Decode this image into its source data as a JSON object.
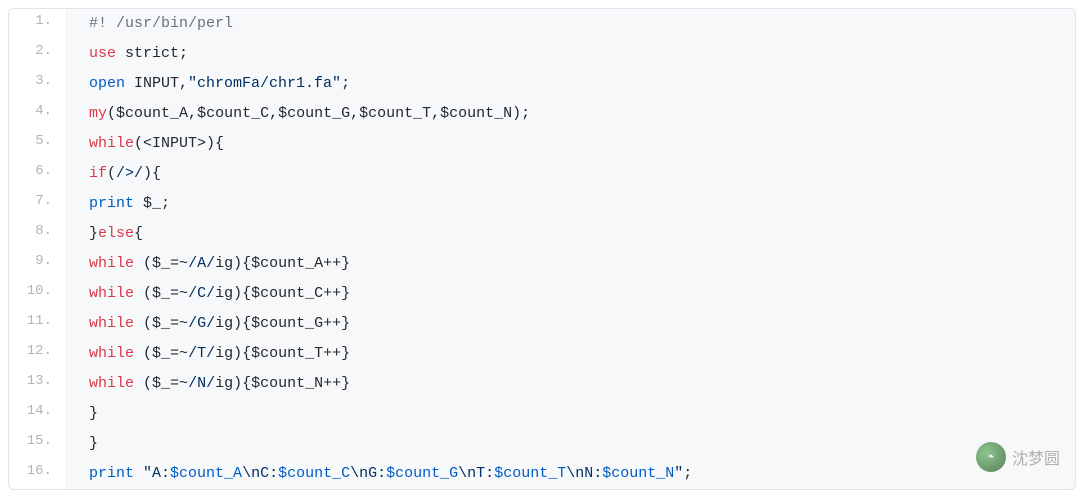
{
  "watermark": {
    "text": "沈梦圆"
  },
  "code": {
    "lines": [
      {
        "n": "1.",
        "tokens": [
          {
            "t": "#! /usr/bin/perl",
            "c": "tok-comment"
          }
        ]
      },
      {
        "n": "2.",
        "tokens": [
          {
            "t": "use",
            "c": "tok-keyword"
          },
          {
            "t": " ",
            "c": "tok-plain"
          },
          {
            "t": "strict",
            "c": "tok-plain"
          },
          {
            "t": ";",
            "c": "tok-punct"
          }
        ]
      },
      {
        "n": "3.",
        "tokens": [
          {
            "t": "open",
            "c": "tok-func"
          },
          {
            "t": " INPUT,",
            "c": "tok-plain"
          },
          {
            "t": "\"chromFa/chr1.fa\"",
            "c": "tok-string"
          },
          {
            "t": ";",
            "c": "tok-punct"
          }
        ]
      },
      {
        "n": "4.",
        "tokens": [
          {
            "t": "my",
            "c": "tok-keyword"
          },
          {
            "t": "(",
            "c": "tok-punct"
          },
          {
            "t": "$count_A",
            "c": "tok-var"
          },
          {
            "t": ",",
            "c": "tok-punct"
          },
          {
            "t": "$count_C",
            "c": "tok-var"
          },
          {
            "t": ",",
            "c": "tok-punct"
          },
          {
            "t": "$count_G",
            "c": "tok-var"
          },
          {
            "t": ",",
            "c": "tok-punct"
          },
          {
            "t": "$count_T",
            "c": "tok-var"
          },
          {
            "t": ",",
            "c": "tok-punct"
          },
          {
            "t": "$count_N",
            "c": "tok-var"
          },
          {
            "t": ");",
            "c": "tok-punct"
          }
        ]
      },
      {
        "n": "5.",
        "tokens": [
          {
            "t": "while",
            "c": "tok-keyword"
          },
          {
            "t": "(<INPUT>){",
            "c": "tok-plain"
          }
        ]
      },
      {
        "n": "6.",
        "tokens": [
          {
            "t": "if",
            "c": "tok-keyword"
          },
          {
            "t": "(",
            "c": "tok-punct"
          },
          {
            "t": "/>/",
            "c": "tok-regex"
          },
          {
            "t": "){",
            "c": "tok-punct"
          }
        ]
      },
      {
        "n": "7.",
        "tokens": [
          {
            "t": "print",
            "c": "tok-func"
          },
          {
            "t": " ",
            "c": "tok-plain"
          },
          {
            "t": "$_",
            "c": "tok-var"
          },
          {
            "t": ";",
            "c": "tok-punct"
          }
        ]
      },
      {
        "n": "8.",
        "tokens": [
          {
            "t": "}",
            "c": "tok-punct"
          },
          {
            "t": "else",
            "c": "tok-keyword"
          },
          {
            "t": "{",
            "c": "tok-punct"
          }
        ]
      },
      {
        "n": "9.",
        "tokens": [
          {
            "t": "while",
            "c": "tok-keyword"
          },
          {
            "t": " (",
            "c": "tok-plain"
          },
          {
            "t": "$_",
            "c": "tok-var"
          },
          {
            "t": "=~",
            "c": "tok-plain"
          },
          {
            "t": "/A/",
            "c": "tok-regex"
          },
          {
            "t": "ig",
            "c": "tok-plain"
          },
          {
            "t": "){",
            "c": "tok-punct"
          },
          {
            "t": "$count_A",
            "c": "tok-var"
          },
          {
            "t": "++}",
            "c": "tok-punct"
          }
        ]
      },
      {
        "n": "10.",
        "tokens": [
          {
            "t": "while",
            "c": "tok-keyword"
          },
          {
            "t": " (",
            "c": "tok-plain"
          },
          {
            "t": "$_",
            "c": "tok-var"
          },
          {
            "t": "=~",
            "c": "tok-plain"
          },
          {
            "t": "/C/",
            "c": "tok-regex"
          },
          {
            "t": "ig",
            "c": "tok-plain"
          },
          {
            "t": "){",
            "c": "tok-punct"
          },
          {
            "t": "$count_C",
            "c": "tok-var"
          },
          {
            "t": "++}",
            "c": "tok-punct"
          }
        ]
      },
      {
        "n": "11.",
        "tokens": [
          {
            "t": "while",
            "c": "tok-keyword"
          },
          {
            "t": " (",
            "c": "tok-plain"
          },
          {
            "t": "$_",
            "c": "tok-var"
          },
          {
            "t": "=~",
            "c": "tok-plain"
          },
          {
            "t": "/G/",
            "c": "tok-regex"
          },
          {
            "t": "ig",
            "c": "tok-plain"
          },
          {
            "t": "){",
            "c": "tok-punct"
          },
          {
            "t": "$count_G",
            "c": "tok-var"
          },
          {
            "t": "++}",
            "c": "tok-punct"
          }
        ]
      },
      {
        "n": "12.",
        "tokens": [
          {
            "t": "while",
            "c": "tok-keyword"
          },
          {
            "t": " (",
            "c": "tok-plain"
          },
          {
            "t": "$_",
            "c": "tok-var"
          },
          {
            "t": "=~",
            "c": "tok-plain"
          },
          {
            "t": "/T/",
            "c": "tok-regex"
          },
          {
            "t": "ig",
            "c": "tok-plain"
          },
          {
            "t": "){",
            "c": "tok-punct"
          },
          {
            "t": "$count_T",
            "c": "tok-var"
          },
          {
            "t": "++}",
            "c": "tok-punct"
          }
        ]
      },
      {
        "n": "13.",
        "tokens": [
          {
            "t": "while",
            "c": "tok-keyword"
          },
          {
            "t": " (",
            "c": "tok-plain"
          },
          {
            "t": "$_",
            "c": "tok-var"
          },
          {
            "t": "=~",
            "c": "tok-plain"
          },
          {
            "t": "/N/",
            "c": "tok-regex"
          },
          {
            "t": "ig",
            "c": "tok-plain"
          },
          {
            "t": "){",
            "c": "tok-punct"
          },
          {
            "t": "$count_N",
            "c": "tok-var"
          },
          {
            "t": "++}",
            "c": "tok-punct"
          }
        ]
      },
      {
        "n": "14.",
        "tokens": [
          {
            "t": "}",
            "c": "tok-punct"
          }
        ]
      },
      {
        "n": "15.",
        "tokens": [
          {
            "t": "}",
            "c": "tok-punct"
          }
        ]
      },
      {
        "n": "16.",
        "tokens": [
          {
            "t": "print",
            "c": "tok-func"
          },
          {
            "t": " ",
            "c": "tok-plain"
          },
          {
            "t": "\"A:",
            "c": "tok-string"
          },
          {
            "t": "$count_A",
            "c": "tok-strvar"
          },
          {
            "t": "\\n",
            "c": "tok-string"
          },
          {
            "t": "C:",
            "c": "tok-string"
          },
          {
            "t": "$count_C",
            "c": "tok-strvar"
          },
          {
            "t": "\\n",
            "c": "tok-string"
          },
          {
            "t": "G:",
            "c": "tok-string"
          },
          {
            "t": "$count_G",
            "c": "tok-strvar"
          },
          {
            "t": "\\n",
            "c": "tok-string"
          },
          {
            "t": "T:",
            "c": "tok-string"
          },
          {
            "t": "$count_T",
            "c": "tok-strvar"
          },
          {
            "t": "\\n",
            "c": "tok-string"
          },
          {
            "t": "N:",
            "c": "tok-string"
          },
          {
            "t": "$count_N",
            "c": "tok-strvar"
          },
          {
            "t": "\"",
            "c": "tok-string"
          },
          {
            "t": ";",
            "c": "tok-punct"
          }
        ]
      }
    ]
  }
}
